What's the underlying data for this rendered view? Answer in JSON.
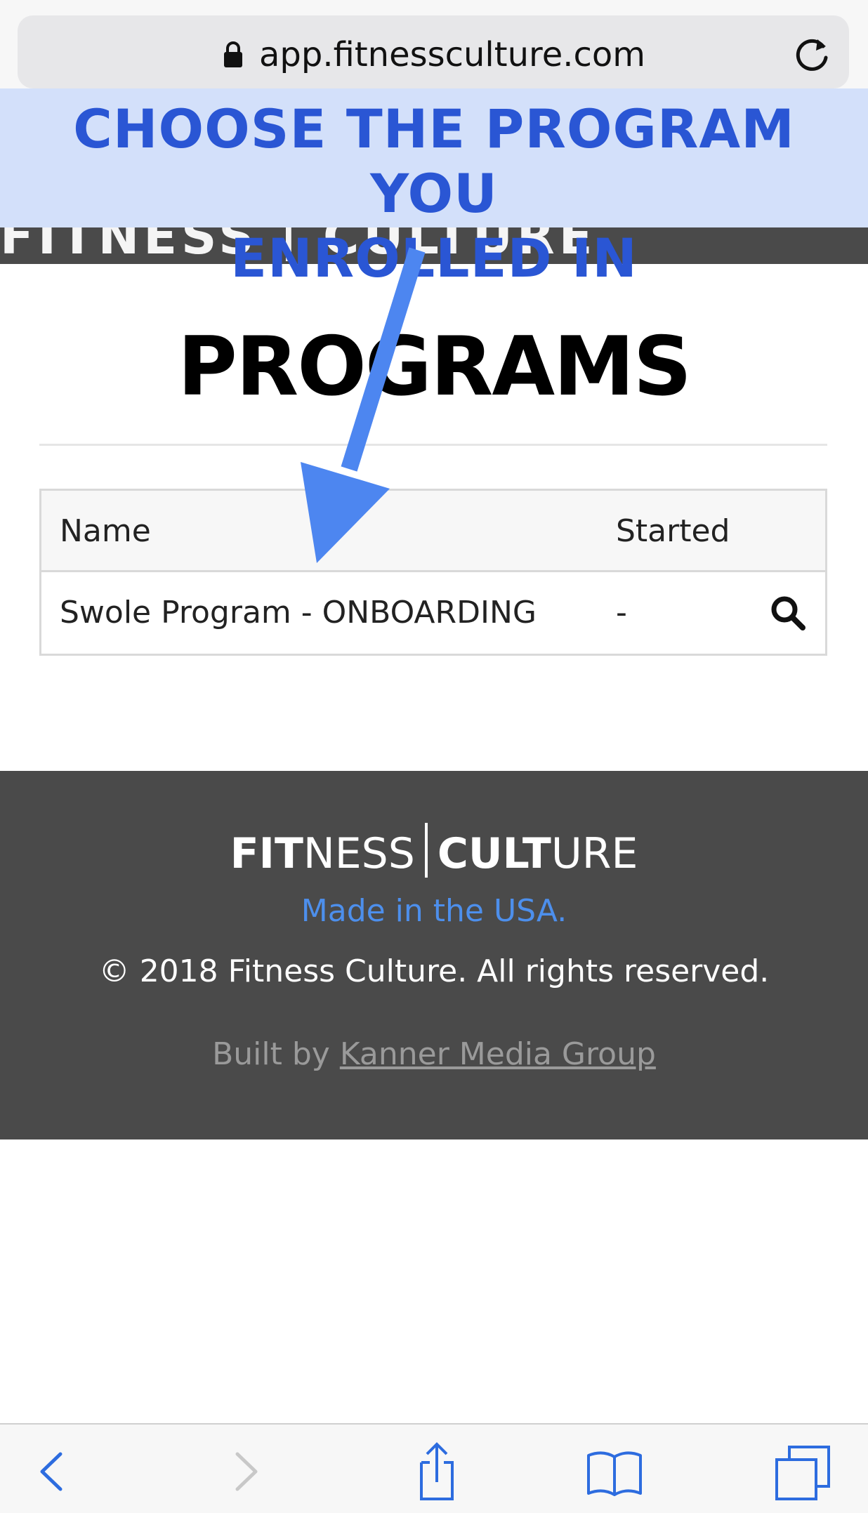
{
  "browser": {
    "url": "app.fitnessculture.com",
    "icons": {
      "lock": "lock-icon",
      "reload": "reload-icon"
    }
  },
  "banner": {
    "line1": "CHOOSE THE PROGRAM YOU",
    "line2": "ENROLLED IN"
  },
  "header": {
    "logo_text": "FITNESS | CULTURE"
  },
  "main": {
    "title": "PROGRAMS",
    "table": {
      "columns": [
        "Name",
        "Started"
      ],
      "rows": [
        {
          "name": "Swole Program - ONBOARDING",
          "started": "-",
          "action_icon": "search-icon"
        }
      ]
    }
  },
  "footer": {
    "logo_left_bold": "FIT",
    "logo_left_thin": "NESS",
    "logo_right_bold": "CULT",
    "logo_right_thin": "URE",
    "made_in": "Made in the USA.",
    "copyright": "© 2018 Fitness Culture. All rights reserved.",
    "built_by_prefix": "Built by ",
    "built_by_link": "Kanner Media Group"
  },
  "toolbar": {
    "icons": [
      "back-icon",
      "forward-icon",
      "share-icon",
      "bookmarks-icon",
      "tabs-icon"
    ]
  },
  "colors": {
    "banner_bg": "#d3e0fa",
    "banner_text": "#2a56d4",
    "arrow": "#4d86f0",
    "dark_bg": "#4a4a4a",
    "link_blue": "#4d8fec"
  }
}
